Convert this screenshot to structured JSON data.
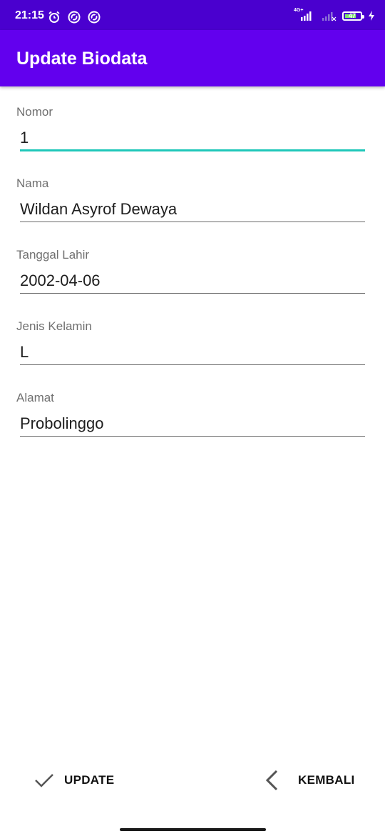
{
  "status_bar": {
    "time": "21:15",
    "network_label": "4G+",
    "battery_level": "47",
    "icons": [
      "alarm-icon",
      "sync-icon",
      "sync-icon",
      "signal-icon",
      "signal-icon",
      "battery-icon",
      "charging-icon"
    ]
  },
  "app_bar": {
    "title": "Update Biodata",
    "color": "#6200ee"
  },
  "form": {
    "fields": [
      {
        "label": "Nomor",
        "value": "1"
      },
      {
        "label": "Nama",
        "value": "Wildan Asyrof Dewaya"
      },
      {
        "label": "Tanggal Lahir",
        "value": "2002-04-06"
      },
      {
        "label": "Jenis Kelamin",
        "value": "L"
      },
      {
        "label": "Alamat",
        "value": "Probolinggo"
      }
    ],
    "focus_color": "#1fc7b9"
  },
  "actions": {
    "update_label": "UPDATE",
    "update_icon": "check-icon",
    "back_label": "KEMBALI",
    "back_icon": "chevron-left-icon"
  }
}
